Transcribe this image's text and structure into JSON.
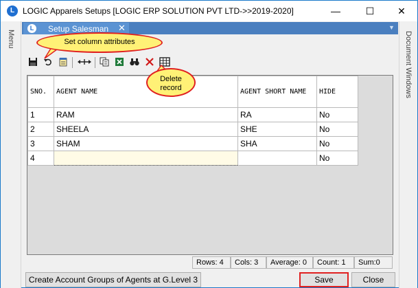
{
  "window": {
    "app_icon_glyph": "L",
    "title": "LOGIC Apparels Setups  [LOGIC ERP SOLUTION PVT LTD->>2019-2020]",
    "minimize": "—",
    "maximize": "☐",
    "close": "✕"
  },
  "side": {
    "left_label": "Menu",
    "right_label": "Document Windows"
  },
  "tab": {
    "label": "Setup Salesman",
    "close": "✕",
    "dropdown": "▼"
  },
  "toolbar": {
    "icons": [
      "save-icon",
      "undo-icon",
      "notepad-icon",
      "column-width-icon",
      "copy-icon",
      "excel-icon",
      "find-icon",
      "delete-icon",
      "grid-icon"
    ]
  },
  "callouts": {
    "set_columns": "Set  column  attributes",
    "delete": "Delete record"
  },
  "table": {
    "columns": [
      "SNO.",
      "AGENT NAME",
      "AGENT SHORT NAME",
      "HIDE"
    ],
    "rows": [
      [
        "1",
        "RAM",
        "RA",
        "No"
      ],
      [
        "2",
        "SHEELA",
        "SHE",
        "No"
      ],
      [
        "3",
        "SHAM",
        "SHA",
        "No"
      ],
      [
        "4",
        "",
        "",
        "No"
      ]
    ]
  },
  "status": {
    "rows": "Rows: 4",
    "cols": "Cols: 3",
    "average": "Average: 0",
    "count": "Count: 1",
    "sum": "Sum:0"
  },
  "buttons": {
    "create_groups": "Create Account Groups of Agents at G.Level 3",
    "save": "Save",
    "close": "Close"
  },
  "colors": {
    "accent": "#1979ca",
    "tab": "#5b93d3",
    "callout": "#fff176",
    "highlight": "#e02020"
  }
}
